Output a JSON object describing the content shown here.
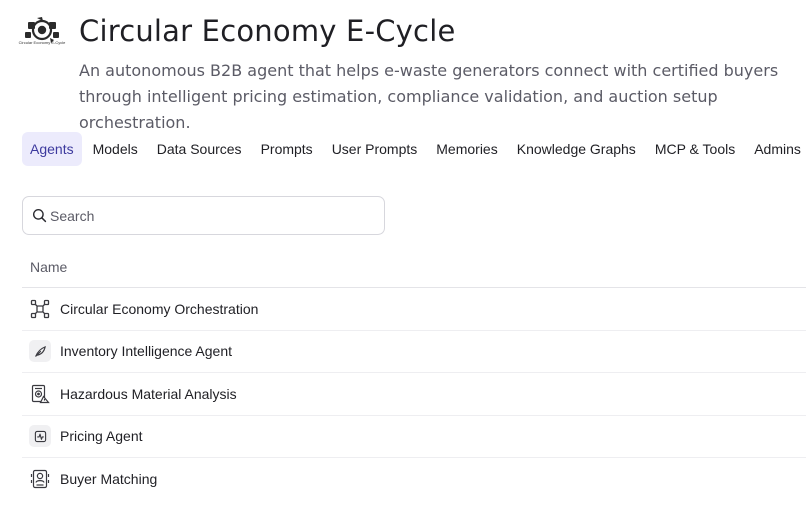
{
  "app": {
    "logo_caption": "Circular Economy E-Cycle",
    "title": "Circular Economy E-Cycle",
    "description": "An autonomous B2B agent that helps e-waste generators connect with certified buyers through intelligent pricing estimation, compliance validation, and auction setup orchestration."
  },
  "tabs": [
    {
      "label": "Agents",
      "active": true
    },
    {
      "label": "Models"
    },
    {
      "label": "Data Sources"
    },
    {
      "label": "Prompts"
    },
    {
      "label": "User Prompts"
    },
    {
      "label": "Memories"
    },
    {
      "label": "Knowledge Graphs"
    },
    {
      "label": "MCP & Tools"
    },
    {
      "label": "Admins"
    }
  ],
  "search": {
    "placeholder": "Search",
    "value": ""
  },
  "table": {
    "column_name": "Name",
    "rows": [
      {
        "name": "Circular Economy Orchestration",
        "icon": "orchestration-network-icon"
      },
      {
        "name": "Inventory Intelligence Agent",
        "icon": "leaf-feather-icon"
      },
      {
        "name": "Hazardous Material Analysis",
        "icon": "hazard-document-icon"
      },
      {
        "name": "Pricing Agent",
        "icon": "pulse-chart-icon"
      },
      {
        "name": "Buyer Matching",
        "icon": "buyer-profile-icon"
      }
    ]
  },
  "colors": {
    "accent": "#3d3a9e",
    "active_tab_bg": "#ecebfc",
    "border": "#d7d7dd",
    "text": "#1f1f24",
    "muted": "#5b5b66"
  }
}
